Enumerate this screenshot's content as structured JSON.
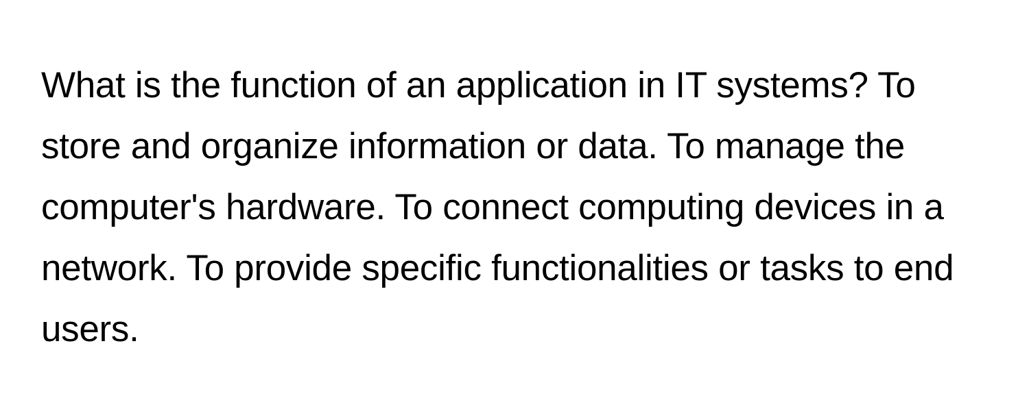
{
  "question": "What is the function of an application in IT systems?",
  "options": [
    "To store and organize information or data.",
    "To manage the computer's hardware.",
    "To connect computing devices in a network.",
    "To provide specific functionalities or tasks to end users."
  ],
  "full_text": "What is the function of an application in IT systems? To store and organize information or data. To manage the computer's hardware. To connect computing devices in a network. To provide specific functionalities or tasks to end users."
}
